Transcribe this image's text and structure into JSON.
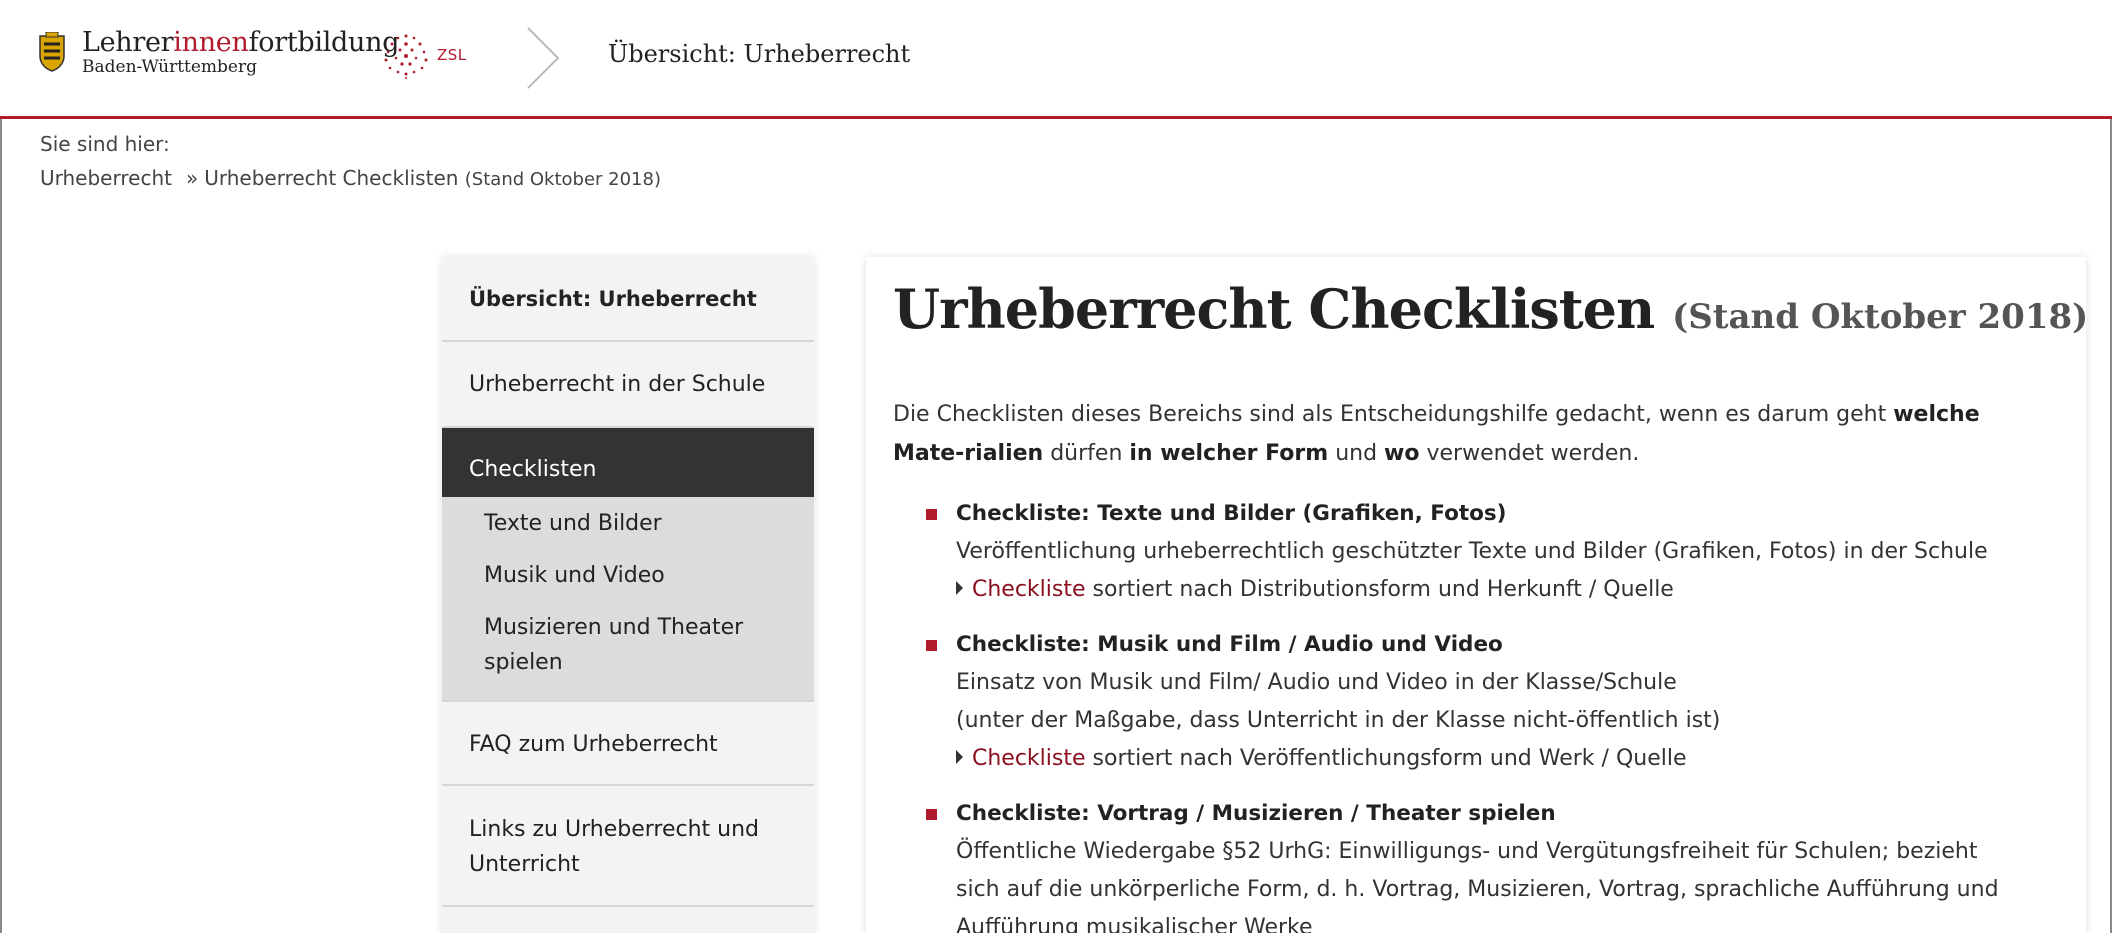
{
  "header": {
    "logo_part1": "Lehrer",
    "logo_part2": "innen",
    "logo_part3": "fortbildung",
    "logo_sub": "Baden-Württemberg",
    "zsl": "ZSL",
    "title": "Übersicht: Urheberrecht"
  },
  "breadcrumb": {
    "label": "Sie sind hier:",
    "item1": "Urheberrecht",
    "separator": "»",
    "item2": "Urheberrecht Checklisten",
    "item2_small": "(Stand Oktober 2018)"
  },
  "sidebar": {
    "items": [
      "Übersicht: Urheberrecht",
      "Urheberrecht in der Schule",
      "Checklisten",
      "FAQ zum Urheberrecht",
      "Links zu Urheberrecht und Unterricht"
    ],
    "subitems": [
      "Texte und Bilder",
      "Musik und Video",
      "Musizieren und Theater spielen"
    ]
  },
  "content": {
    "title": "Urheberrecht Checklisten",
    "title_stand": "(Stand Oktober 2018)",
    "intro": {
      "t1": "Die Checklisten dieses Bereichs sind als Entscheidungshilfe gedacht, wenn es darum geht ",
      "b1": "welche Mate-rialien",
      "t2": " dürfen ",
      "b2": "in welcher Form",
      "t3": " und ",
      "b3": "wo",
      "t4": " verwendet werden."
    },
    "list": [
      {
        "title": "Checkliste: Texte und Bilder (Grafiken, Fotos)",
        "lines": [
          "Veröffentlichung urheberrechtlich geschützter Texte und Bilder (Grafiken, Fotos) in der Schule"
        ],
        "link": "Checkliste",
        "link_rest": " sortiert nach Distributionsform und Herkunft / Quelle"
      },
      {
        "title": "Checkliste: Musik und Film / Audio und Video",
        "lines": [
          "Einsatz von Musik und Film/ Audio und Video in der Klasse/Schule",
          "(unter der Maßgabe, dass Unterricht in der Klasse nicht-öffentlich ist)"
        ],
        "link": "Checkliste",
        "link_rest": " sortiert nach Veröffentlichungsform und Werk / Quelle"
      },
      {
        "title": "Checkliste: Vortrag / Musizieren / Theater spielen",
        "lines": [
          "Öffentliche Wiedergabe §52 UrhG: Einwilligungs- und Vergütungsfreiheit für Schulen; bezieht",
          "sich auf die unkörperliche Form, d. h. Vortrag, Musizieren, Vortrag, sprachliche Aufführung und",
          "Aufführung musikalischer Werke"
        ]
      }
    ]
  },
  "colors": {
    "accent": "#b01c2e",
    "link": "#8b1020",
    "active_bg": "#333333"
  }
}
